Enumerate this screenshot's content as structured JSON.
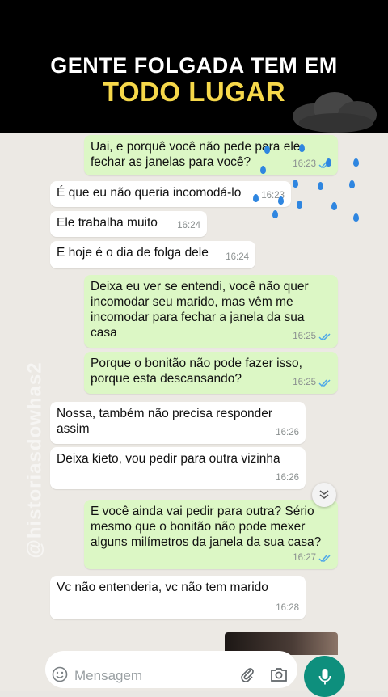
{
  "banner": {
    "line1": "GENTE FOLGADA TEM EM",
    "line2": "TODO LUGAR",
    "line1_color": "#ffffff",
    "line2_color": "#f6d84a"
  },
  "watermark": "@historiasdowhas2",
  "messages": [
    {
      "dir": "out",
      "text": "Uai, e porquê você não pede para ele\nfechar as janelas para você?",
      "time": "16:23",
      "read": true
    },
    {
      "dir": "in",
      "text": "É que eu não queria incomodá-lo",
      "time": "16:23"
    },
    {
      "dir": "in",
      "text": "Ele trabalha muito",
      "time": "16:24"
    },
    {
      "dir": "in",
      "text": "E hoje é o dia de folga dele",
      "time": "16:24"
    },
    {
      "dir": "out",
      "text": "Deixa eu ver se entendi, você não quer\nincomodar seu marido, mas vêm me\nincomodar para fechar a janela da sua\ncasa",
      "time": "16:25",
      "read": true
    },
    {
      "dir": "out",
      "text": "Porque o bonitão não pode fazer isso,\nporque esta descansando?",
      "time": "16:25",
      "read": true
    },
    {
      "dir": "in",
      "text": "Nossa, também não precisa responder\nassim",
      "time": "16:26"
    },
    {
      "dir": "in",
      "text": "Deixa kieto, vou pedir para outra vizinha",
      "time": "16:26"
    },
    {
      "dir": "out",
      "text": "E você ainda vai pedir para outra? Sério\nmesmo que o bonitão não pode mexer\nalguns milímetros da janela da sua casa?",
      "time": "16:27",
      "read": true
    },
    {
      "dir": "in",
      "text": "Vc não entenderia, vc não tem marido",
      "time": "16:28"
    }
  ],
  "input": {
    "placeholder": "Mensagem"
  },
  "icons": {
    "emoji": "emoji-icon",
    "attach": "paperclip-icon",
    "camera": "camera-icon",
    "mic": "microphone-icon",
    "scroll": "chevron-double-down-icon",
    "decor": "storm-cloud-icon"
  },
  "colors": {
    "outgoing_bubble": "#dcf7c5",
    "incoming_bubble": "#ffffff",
    "read_tick": "#4fa8e8",
    "mic_button": "#0e8f7d"
  }
}
